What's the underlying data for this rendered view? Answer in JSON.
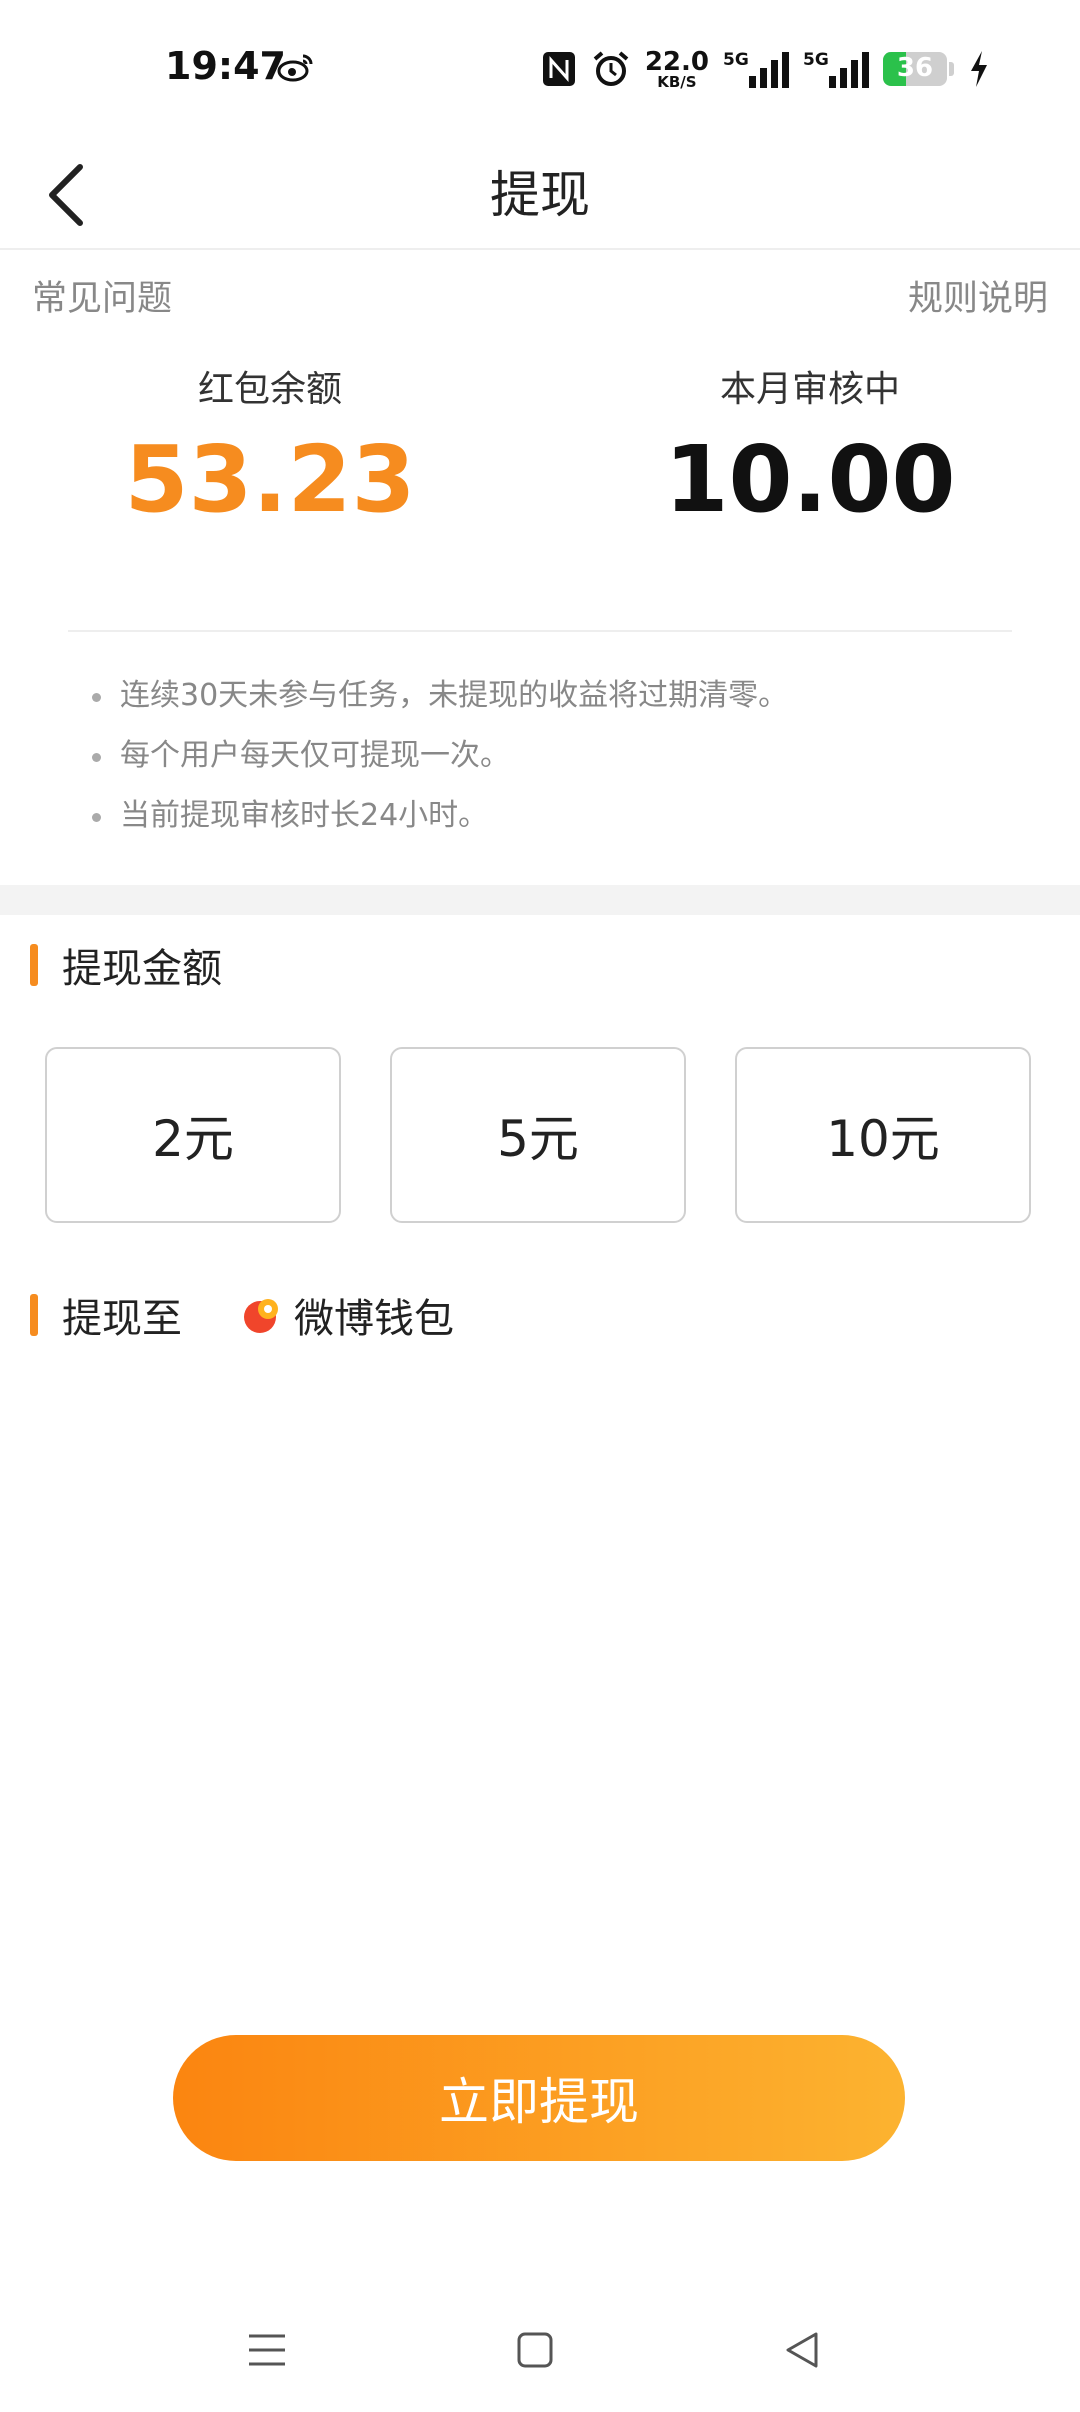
{
  "status_bar": {
    "time": "19:47",
    "net_speed_value": "22.0",
    "net_speed_unit": "KB/S",
    "signal1_label": "5G",
    "signal2_label": "5G",
    "battery_percent": "36",
    "battery_level": 0.36,
    "battery_color": "#2bc14b"
  },
  "header": {
    "title": "提现"
  },
  "links": {
    "faq": "常见问题",
    "rules": "规则说明"
  },
  "balance": {
    "redpacket_label": "红包余额",
    "redpacket_value": "53.23",
    "review_label": "本月审核中",
    "review_value": "10.00"
  },
  "notes": [
    "连续30天未参与任务，未提现的收益将过期清零。",
    "每个用户每天仅可提现一次。",
    "当前提现审核时长24小时。"
  ],
  "amount_section": {
    "title": "提现金额",
    "options": [
      "2元",
      "5元",
      "10元"
    ]
  },
  "destination": {
    "title": "提现至",
    "wallet": "微博钱包"
  },
  "withdraw_button": "立即提现",
  "colors": {
    "accent": "#f68c1f",
    "button_start": "#fb8510",
    "button_end": "#fcb330"
  }
}
